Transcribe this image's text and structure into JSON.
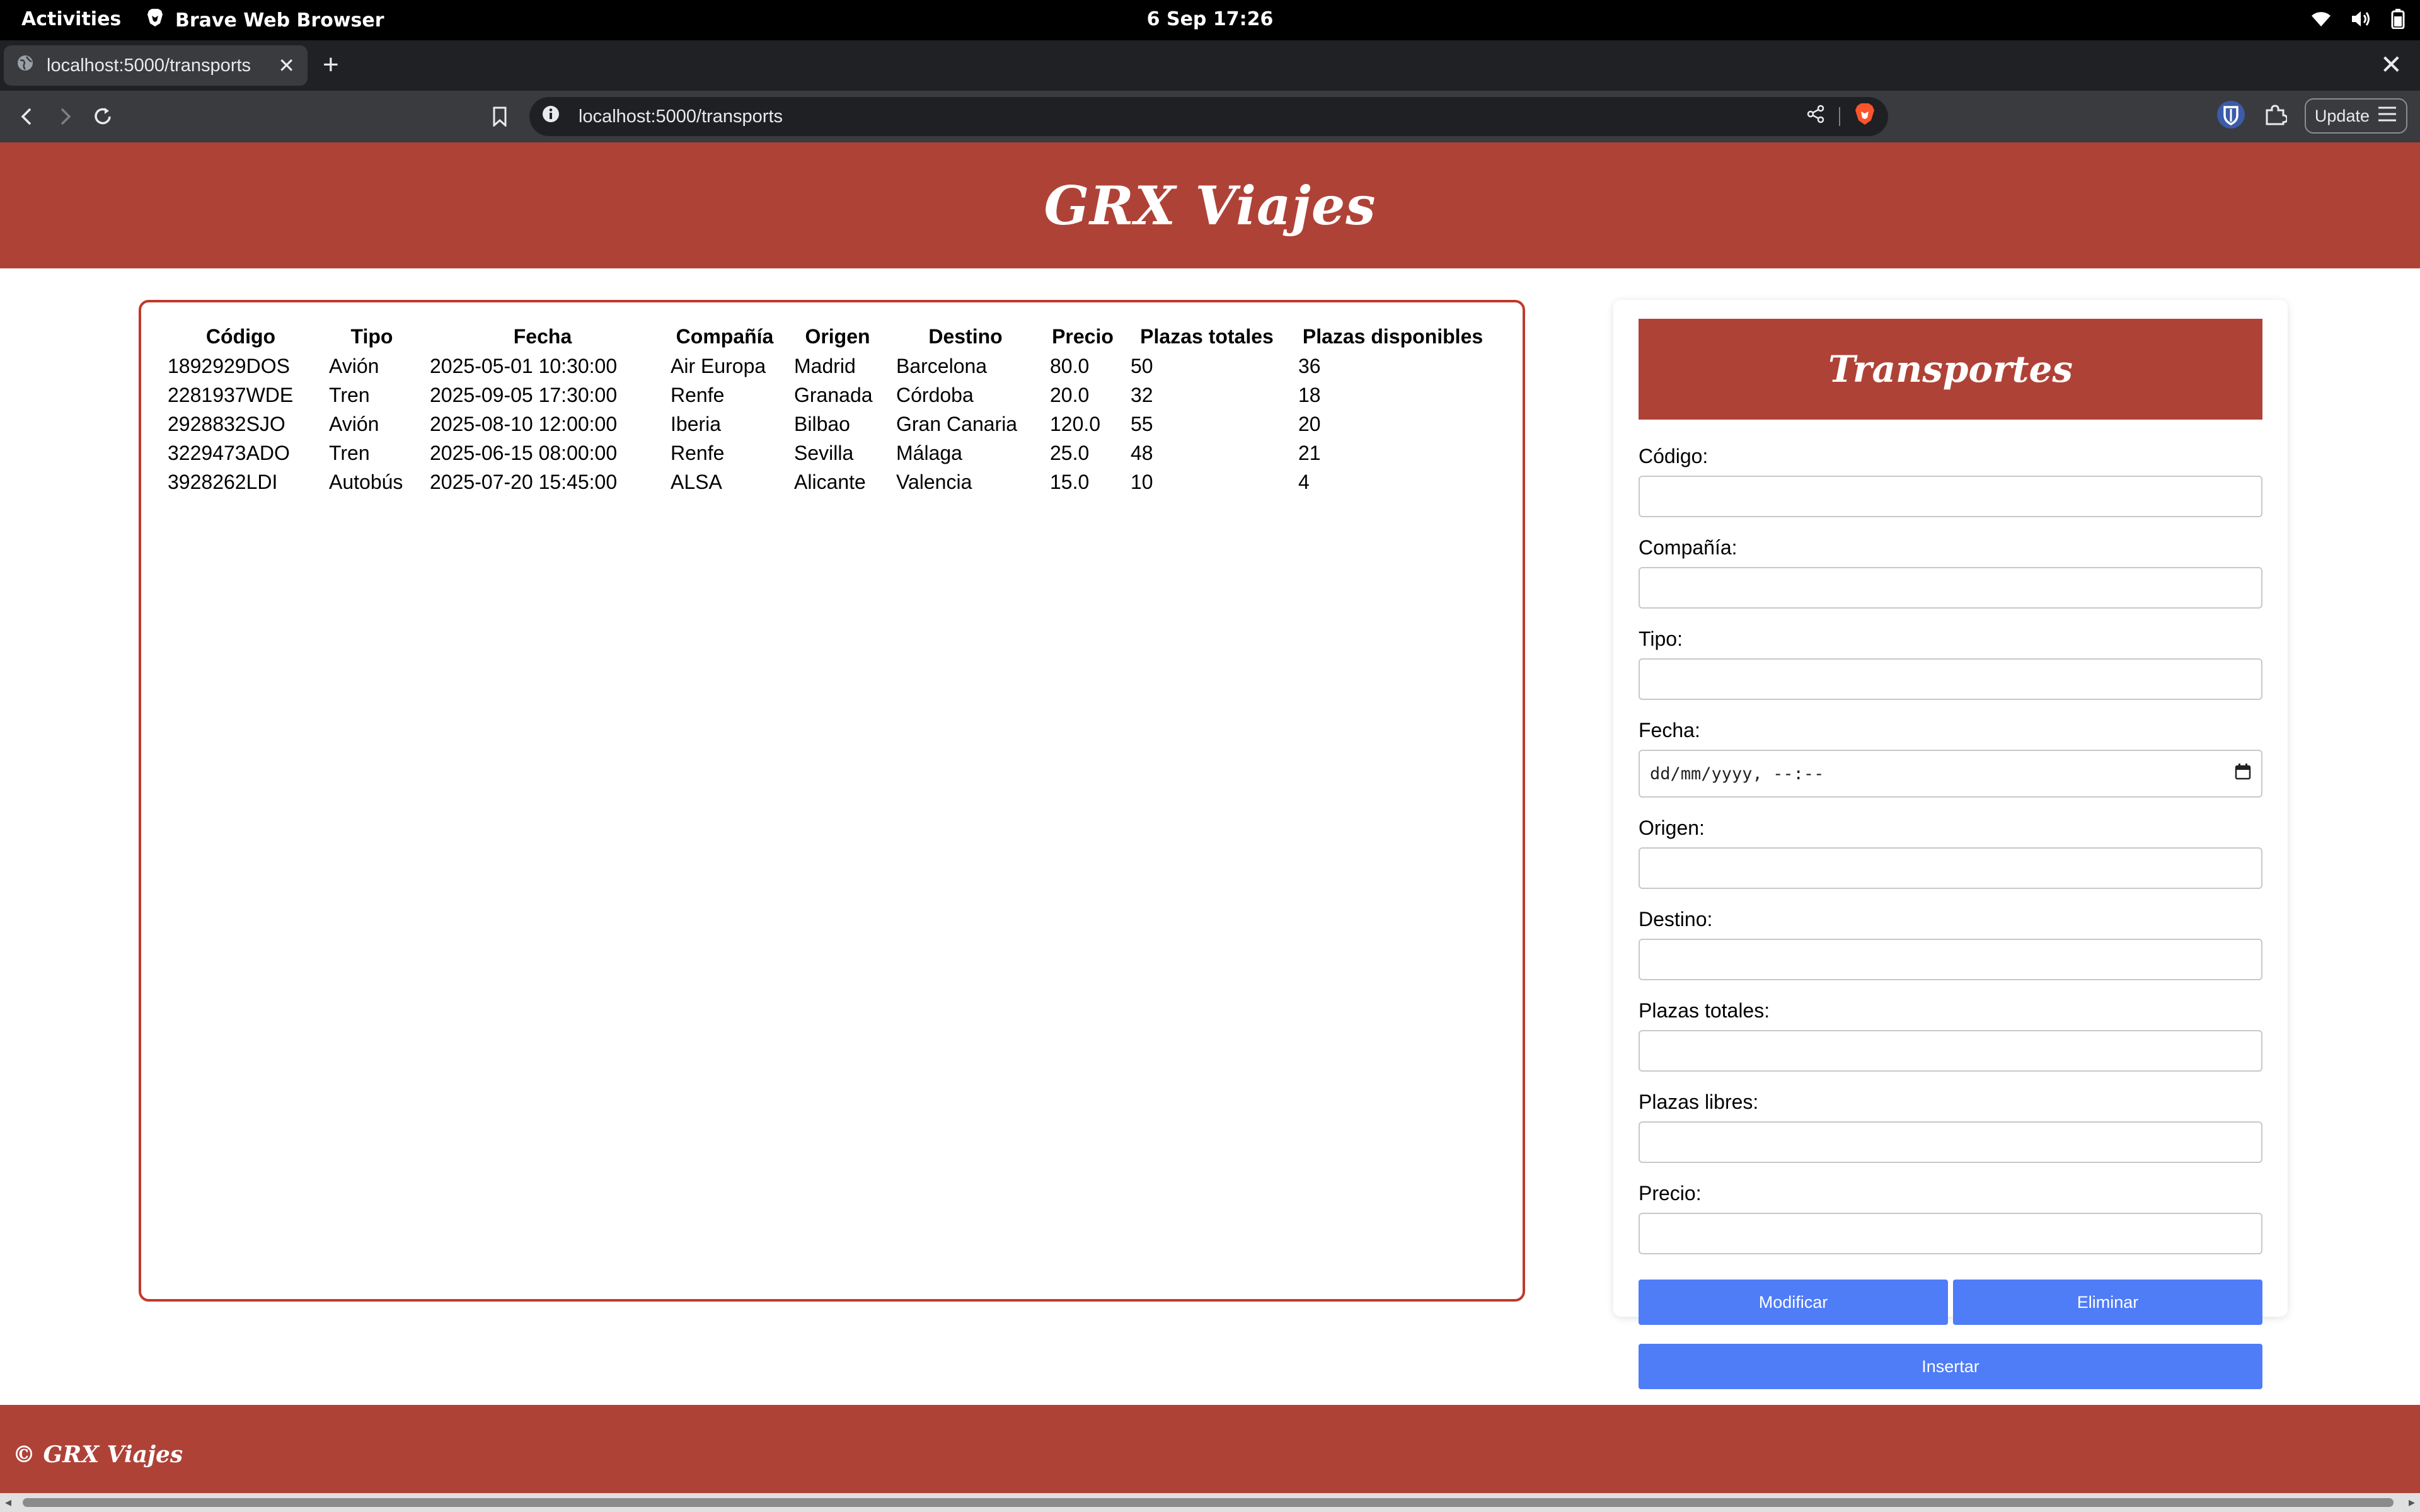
{
  "system_bar": {
    "activities": "Activities",
    "app_name": "Brave Web Browser",
    "clock": "6 Sep  17:26"
  },
  "browser": {
    "tab_title": "localhost:5000/transports",
    "url": "localhost:5000/transports",
    "update_label": "Update"
  },
  "site": {
    "title": "GRX Viajes",
    "footer": "© GRX Viajes",
    "brand_color": "#af4237",
    "button_color": "#4f7cf7"
  },
  "table": {
    "headers": [
      "Código",
      "Tipo",
      "Fecha",
      "Compañía",
      "Origen",
      "Destino",
      "Precio",
      "Plazas totales",
      "Plazas disponibles"
    ],
    "rows": [
      [
        "1892929DOS",
        "Avión",
        "2025-05-01 10:30:00",
        "Air Europa",
        "Madrid",
        "Barcelona",
        "80.0",
        "50",
        "36"
      ],
      [
        "2281937WDE",
        "Tren",
        "2025-09-05 17:30:00",
        "Renfe",
        "Granada",
        "Córdoba",
        "20.0",
        "32",
        "18"
      ],
      [
        "2928832SJO",
        "Avión",
        "2025-08-10 12:00:00",
        "Iberia",
        "Bilbao",
        "Gran Canaria",
        "120.0",
        "55",
        "20"
      ],
      [
        "3229473ADO",
        "Tren",
        "2025-06-15 08:00:00",
        "Renfe",
        "Sevilla",
        "Málaga",
        "25.0",
        "48",
        "21"
      ],
      [
        "3928262LDI",
        "Autobús",
        "2025-07-20 15:45:00",
        "ALSA",
        "Alicante",
        "Valencia",
        "15.0",
        "10",
        "4"
      ]
    ]
  },
  "form": {
    "title": "Transportes",
    "fields": {
      "codigo": {
        "label": "Código:",
        "value": ""
      },
      "compania": {
        "label": "Compañía:",
        "value": ""
      },
      "tipo": {
        "label": "Tipo:",
        "value": ""
      },
      "fecha": {
        "label": "Fecha:",
        "placeholder": "dd/mm/yyyy, --:--"
      },
      "origen": {
        "label": "Origen:",
        "value": ""
      },
      "destino": {
        "label": "Destino:",
        "value": ""
      },
      "plazas_totales": {
        "label": "Plazas totales:",
        "value": ""
      },
      "plazas_libres": {
        "label": "Plazas libres:",
        "value": ""
      },
      "precio": {
        "label": "Precio:",
        "value": ""
      }
    },
    "buttons": {
      "modificar": "Modificar",
      "eliminar": "Eliminar",
      "insertar": "Insertar"
    }
  }
}
